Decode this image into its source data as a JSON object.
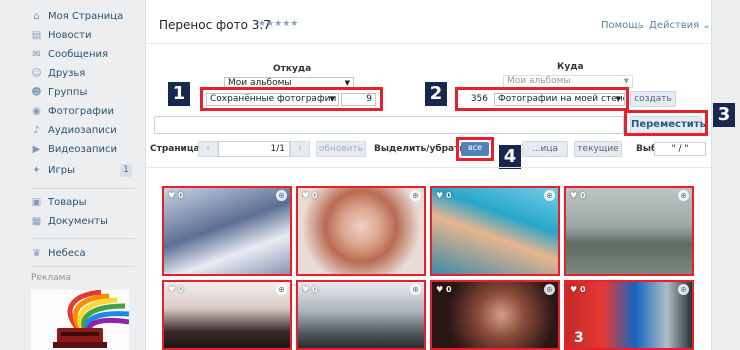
{
  "sidebar": {
    "items": [
      {
        "label": "Моя Страница",
        "icon": "home-icon",
        "glyph": "⌂"
      },
      {
        "label": "Новости",
        "icon": "news-icon",
        "glyph": "▤"
      },
      {
        "label": "Сообщения",
        "icon": "messages-icon",
        "glyph": "✉"
      },
      {
        "label": "Друзья",
        "icon": "friends-icon",
        "glyph": "☺"
      },
      {
        "label": "Группы",
        "icon": "groups-icon",
        "glyph": "☻"
      },
      {
        "label": "Фотографии",
        "icon": "camera-icon",
        "glyph": "◉"
      },
      {
        "label": "Аудиозаписи",
        "icon": "music-icon",
        "glyph": "♪"
      },
      {
        "label": "Видеозаписи",
        "icon": "video-icon",
        "glyph": "▶"
      },
      {
        "label": "Игры",
        "icon": "games-icon",
        "glyph": "✦",
        "counter": "1"
      }
    ],
    "items2": [
      {
        "label": "Товары",
        "icon": "shop-icon",
        "glyph": "▣"
      },
      {
        "label": "Документы",
        "icon": "docs-icon",
        "glyph": "▦"
      }
    ],
    "items3": [
      {
        "label": "Небеса",
        "icon": "crown-icon",
        "glyph": "♛"
      }
    ],
    "ads_label": "Реклама"
  },
  "header": {
    "title": "Перенос фото 3.7",
    "stars": "★★★★★",
    "help": "Помощь",
    "actions": "Действия ⌄"
  },
  "from": {
    "label": "Откуда",
    "album_select": "Мои альбомы",
    "sub_select": "Сохранённые фотографии",
    "count": "9"
  },
  "to": {
    "label": "Куда",
    "album_select": "Мои альбомы",
    "count": "356",
    "sub_select": "Фотографии на моей стене",
    "create_btn": "создать"
  },
  "move_btn": "Переместить",
  "pager": {
    "page_label": "Страница:",
    "prev": "‹",
    "page_value": "1/1",
    "next": "›",
    "refresh": "обновить",
    "select_label": "Выделить/убрать:",
    "all_btn": "все",
    "page_btn": "...ица",
    "current_btn": "текущие",
    "chosen_label": "Выбрано:",
    "chosen_value": "\" / \""
  },
  "badges": [
    "1",
    "2",
    "3",
    "4"
  ],
  "photos": [
    {
      "likes": "♥ 0",
      "num": ""
    },
    {
      "likes": "♥ 0",
      "num": ""
    },
    {
      "likes": "♥ 0",
      "num": ""
    },
    {
      "likes": "♥ 0",
      "num": ""
    },
    {
      "likes": "♥ 0",
      "num": ""
    },
    {
      "likes": "♥ 0",
      "num": ""
    },
    {
      "likes": "♥ 0",
      "num": ""
    },
    {
      "likes": "♥ 0",
      "num": "3"
    }
  ],
  "colors": {
    "accent": "#5181b8",
    "annotation": "#e8202a",
    "badge": "#16284f",
    "link": "#285473"
  }
}
